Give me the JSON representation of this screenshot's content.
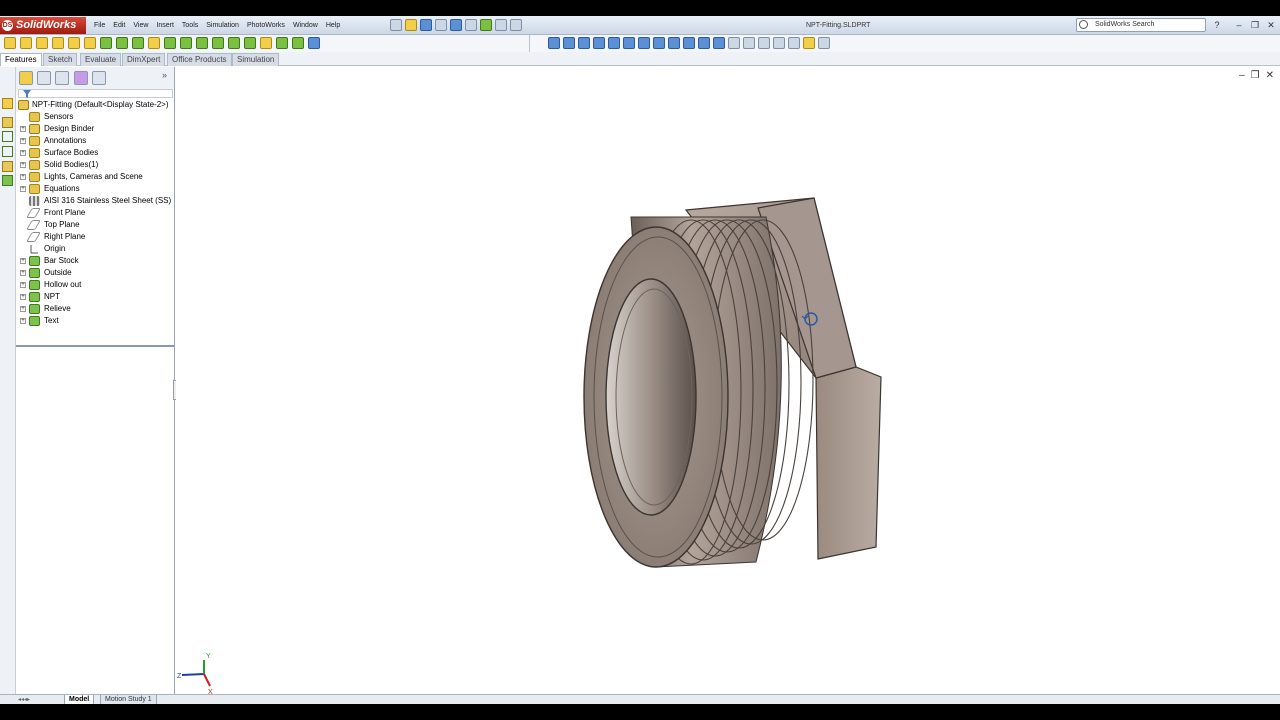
{
  "app": {
    "name": "SolidWorks",
    "document": "NPT-Fitting.SLDPRT"
  },
  "menu": [
    "File",
    "Edit",
    "View",
    "Insert",
    "Tools",
    "Simulation",
    "PhotoWorks",
    "Window",
    "Help"
  ],
  "search": {
    "placeholder": "SolidWorks Search"
  },
  "command_tabs": [
    "Features",
    "Sketch",
    "Evaluate",
    "DimXpert",
    "Office Products",
    "Simulation"
  ],
  "active_tab": "Features",
  "tree": {
    "root": "NPT-Fitting  (Default<Display State-2>)",
    "items": [
      {
        "label": "Sensors",
        "icon": "folder-icon",
        "expand": ""
      },
      {
        "label": "Design Binder",
        "icon": "binder-icon",
        "expand": "+"
      },
      {
        "label": "Annotations",
        "icon": "annotation-icon",
        "expand": "+"
      },
      {
        "label": "Surface Bodies",
        "icon": "folder-icon",
        "expand": "+"
      },
      {
        "label": "Solid Bodies(1)",
        "icon": "folder-icon",
        "expand": "+"
      },
      {
        "label": "Lights, Cameras and Scene",
        "icon": "folder-icon",
        "expand": "+"
      },
      {
        "label": "Equations",
        "icon": "folder-icon",
        "expand": "+"
      },
      {
        "label": "AISI 316 Stainless Steel Sheet (SS)",
        "icon": "material-icon",
        "expand": ""
      },
      {
        "label": "Front Plane",
        "icon": "plane-icon",
        "expand": ""
      },
      {
        "label": "Top Plane",
        "icon": "plane-icon",
        "expand": ""
      },
      {
        "label": "Right Plane",
        "icon": "plane-icon",
        "expand": ""
      },
      {
        "label": "Origin",
        "icon": "origin-icon",
        "expand": ""
      },
      {
        "label": "Bar Stock",
        "icon": "feature-icon",
        "expand": "+"
      },
      {
        "label": "Outside",
        "icon": "feature-icon",
        "expand": "+"
      },
      {
        "label": "Hollow out",
        "icon": "feature-icon",
        "expand": "+"
      },
      {
        "label": "NPT",
        "icon": "feature-icon",
        "expand": "+"
      },
      {
        "label": "Relieve",
        "icon": "feature-icon",
        "expand": "+"
      },
      {
        "label": "Text",
        "icon": "feature-icon",
        "expand": "+"
      }
    ]
  },
  "bottom_tabs": [
    "Model",
    "Motion Study 1"
  ],
  "triad": {
    "axes": [
      "Z",
      "X",
      "Y"
    ]
  },
  "colors": {
    "part": "#9a8a80",
    "part_dark": "#4e4540",
    "accent": "#2b5aa0"
  }
}
